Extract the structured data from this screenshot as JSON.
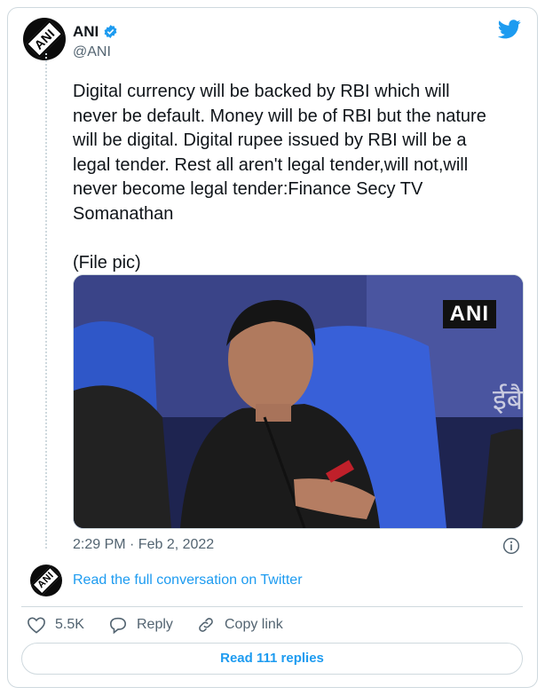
{
  "author": {
    "name": "ANI",
    "handle": "@ANI",
    "avatar_text": "ANI",
    "verified": true
  },
  "tweet": {
    "text": "Digital currency will be backed by RBI which will\nnever be default. Money will be of RBI but the nature\nwill be digital. Digital rupee issued by RBI will be a\nlegal tender. Rest all aren't legal tender,will not,will\nnever become legal tender:Finance Secy TV\nSomanathan\n\n(File pic)",
    "media_watermark": "ANI",
    "media_background_text": "ईबै",
    "timestamp": "2:29 PM · Feb 2, 2022"
  },
  "conversation_link": "Read the full conversation on Twitter",
  "actions": {
    "like_count": "5.5K",
    "reply_label": "Reply",
    "copy_link_label": "Copy link"
  },
  "read_replies_label": "Read 111 replies",
  "colors": {
    "accent": "#1d9bf0",
    "muted": "#536471",
    "border": "#cfd9de",
    "text": "#0f1419"
  },
  "icons": [
    "ani-avatar",
    "verified-badge-icon",
    "twitter-bird-icon",
    "info-icon",
    "heart-icon",
    "reply-bubble-icon",
    "link-icon"
  ]
}
